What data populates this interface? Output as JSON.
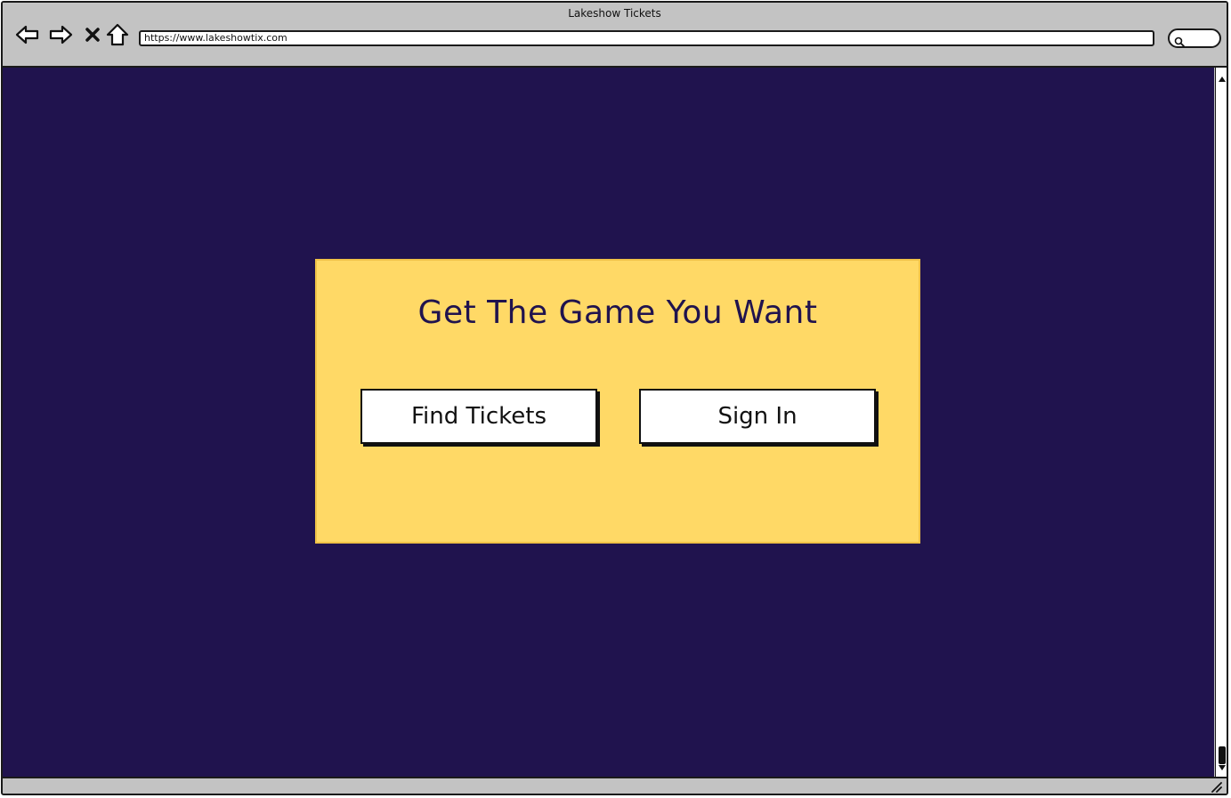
{
  "window": {
    "title": "Lakeshow Tickets"
  },
  "toolbar": {
    "back_icon": "back-arrow-icon",
    "forward_icon": "forward-arrow-icon",
    "stop_icon": "close-icon",
    "home_icon": "home-icon",
    "address": "https://www.lakeshowtix.com",
    "search_icon": "search-icon"
  },
  "colors": {
    "page_background": "#20134e",
    "card_background": "#ffd966",
    "title_color": "#20134e",
    "chrome": "#c3c3c3"
  },
  "main": {
    "heading": "Get The Game You Want",
    "buttons": {
      "find_tickets": "Find Tickets",
      "sign_in": "Sign In"
    }
  }
}
